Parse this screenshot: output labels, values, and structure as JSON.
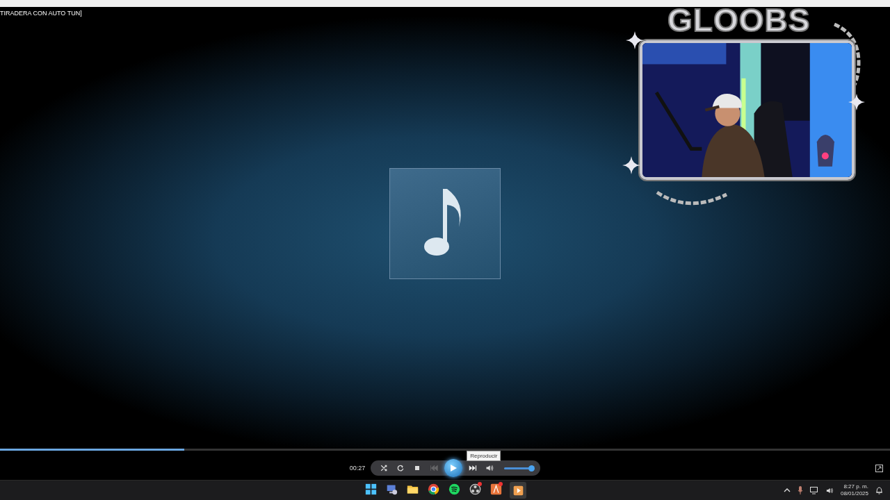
{
  "window": {
    "title": "TIRADERA CON AUTO TUN]"
  },
  "overlay": {
    "logo": "GLOOBS"
  },
  "player": {
    "seek": {
      "level": 0.207
    },
    "time": "00:27",
    "buttons": [
      {
        "kind": "shuffle",
        "disabled": false
      },
      {
        "kind": "repeat",
        "disabled": false
      },
      {
        "kind": "stop",
        "disabled": false
      },
      {
        "kind": "previous",
        "disabled": true
      },
      {
        "kind": "play",
        "disabled": false
      },
      {
        "kind": "next",
        "disabled": false
      },
      {
        "kind": "mute",
        "disabled": false
      }
    ],
    "volume": {
      "level": 0.95
    },
    "tooltip": "Reproducir"
  },
  "taskbar": {
    "apps": [
      {
        "kind": "start",
        "selected": false,
        "notification": false
      },
      {
        "kind": "computer",
        "selected": false,
        "notification": false
      },
      {
        "kind": "folder",
        "selected": false,
        "notification": false
      },
      {
        "kind": "browser",
        "selected": false,
        "notification": false
      },
      {
        "kind": "music",
        "selected": false,
        "notification": false
      },
      {
        "kind": "recorder",
        "selected": false,
        "notification": true
      },
      {
        "kind": "editor",
        "selected": false,
        "notification": true
      },
      {
        "kind": "media",
        "selected": true,
        "notification": false
      }
    ],
    "clock": {
      "time": "8:27 p. m.",
      "date": "08/01/2025"
    }
  }
}
